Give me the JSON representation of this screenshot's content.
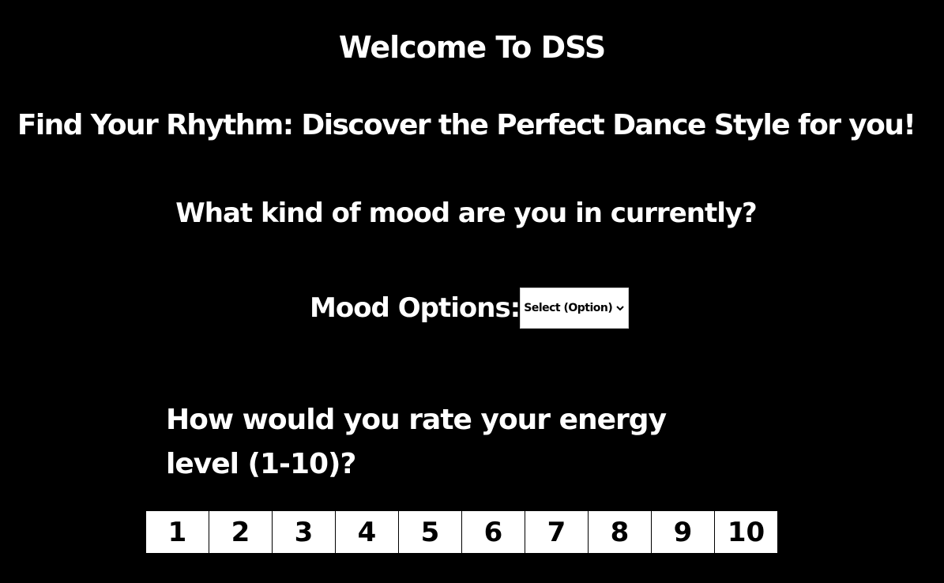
{
  "header": {
    "title": "Welcome To DSS",
    "subtitle": "Find Your Rhythm: Discover the Perfect Dance Style for you!"
  },
  "mood": {
    "question": "What kind of mood are you in currently?",
    "label": "Mood Options:",
    "select_value": "Select (Option)"
  },
  "energy": {
    "question": "How would you rate your energy level (1-10)?",
    "options": [
      "1",
      "2",
      "3",
      "4",
      "5",
      "6",
      "7",
      "8",
      "9",
      "10"
    ]
  }
}
